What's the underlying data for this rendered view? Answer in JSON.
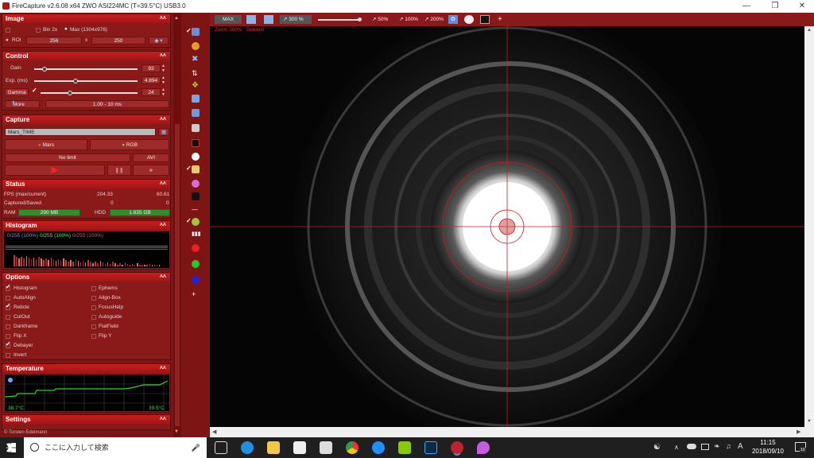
{
  "window": {
    "title": "FireCapture v2.6.08  x64    ZWO ASI224MC (T=39.5°C) USB3.0",
    "minimize_icon": "minimize-icon",
    "maximize_icon": "maximize-icon",
    "close_icon": "close-icon"
  },
  "image": {
    "header": "Image",
    "bin_label": "Bin 2x",
    "max_label": "Max (1304x976)",
    "roi_label": "ROI",
    "roi_w": "256",
    "roi_x": "x",
    "roi_h": "250"
  },
  "control": {
    "header": "Control",
    "gain_label": "Gain",
    "gain_value": "93",
    "gain_pct": 0.1,
    "exp_label": "Exp. (ms)",
    "exp_value": "4.894",
    "exp_pct": 0.4,
    "gamma_label": "Gamma",
    "gamma_value": "24",
    "gamma_pct": 0.3,
    "more_label": "More",
    "range": "1.00 - 10 ms"
  },
  "capture": {
    "header": "Capture",
    "filename": "Mars_TIME",
    "target": "Mars",
    "color": "RGB",
    "limit": "No limit",
    "format": "AVI"
  },
  "status": {
    "header": "Status",
    "fps_label": "FPS (max/current)",
    "fps_max": "204.33",
    "fps_cur": "60.61",
    "cs_label": "Captured/Saved",
    "captured": "0",
    "saved": "0",
    "ram_label": "RAM",
    "ram_value": "290 MB",
    "hdd_label": "HDD",
    "hdd_value": "1.835 GB"
  },
  "histogram": {
    "header": "Histogram",
    "r": "0/255 (100%)",
    "g": "0/255 (100%)",
    "b": "0/255 (100%)"
  },
  "options": {
    "header": "Options",
    "left": [
      {
        "label": "Histogram",
        "checked": true
      },
      {
        "label": "AutoAlign",
        "checked": false
      },
      {
        "label": "Reticle",
        "checked": true
      },
      {
        "label": "CutOut",
        "checked": false
      },
      {
        "label": "Darkframe",
        "checked": false
      },
      {
        "label": "Flip X",
        "checked": false
      },
      {
        "label": "Debayer",
        "checked": true
      },
      {
        "label": "Invert",
        "checked": false
      }
    ],
    "right": [
      {
        "label": "Ephems"
      },
      {
        "label": "Align-Box"
      },
      {
        "label": "FocusHelp"
      },
      {
        "label": "Autoguide"
      },
      {
        "label": "FlatField"
      },
      {
        "label": "Flip Y"
      }
    ]
  },
  "temperature": {
    "header": "Temperature",
    "min": "38.7°C",
    "max": "39.5°C"
  },
  "settings": {
    "header": "Settings"
  },
  "author": "© Torsten Edelmann",
  "toolbar": {
    "max": "MAX",
    "zoom": "300 %",
    "z50": "50%",
    "z100": "100%",
    "z200": "200%",
    "plus": "+"
  },
  "view": {
    "zoom_note": "Zoom: 300%",
    "debayer_note": "Debayer"
  },
  "taskbar": {
    "search_placeholder": "ここに入力して検索",
    "time": "11:15",
    "date": "2018/09/10",
    "ime": "A",
    "notif_count": "10"
  },
  "colors": {
    "panel": "#7e1515",
    "header": "#c42020",
    "accent": "#2f8f2f"
  }
}
